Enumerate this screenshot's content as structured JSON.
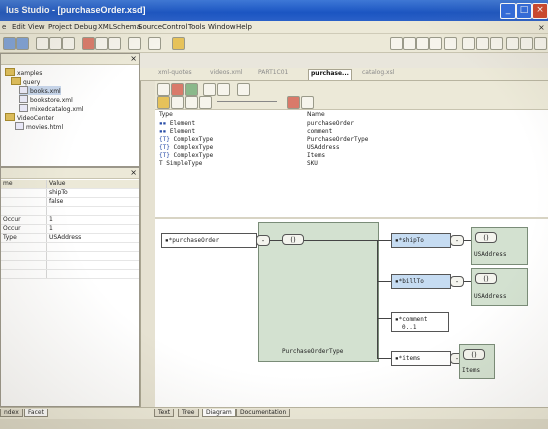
{
  "window": {
    "title": "lus Studio - [purchaseOrder.xsd]"
  },
  "menu": [
    "Edit",
    "View",
    "Project",
    "Debug",
    "XMLSchema",
    "SourceControl",
    "Tools",
    "Window",
    "Help"
  ],
  "menu_first_partial": "e",
  "project_tree": {
    "items": [
      "xamples",
      "query",
      "books.xml",
      "bookstore.xml",
      "mixedcatalog.xml",
      "VideoCenter",
      "movies.html"
    ]
  },
  "properties": {
    "header": {
      "name": "me",
      "value": "Value"
    },
    "rows": [
      {
        "name": "",
        "value": "shipTo"
      },
      {
        "name": "",
        "value": "false"
      },
      {
        "name": "",
        "value": ""
      },
      {
        "name": "Occur",
        "value": "1"
      },
      {
        "name": "Occur",
        "value": "1"
      },
      {
        "name": "Type",
        "value": "USAddress"
      },
      {
        "name": "",
        "value": ""
      },
      {
        "name": "",
        "value": ""
      },
      {
        "name": "",
        "value": ""
      },
      {
        "name": "",
        "value": ""
      }
    ]
  },
  "left_bottom_tabs": {
    "first": "ndex",
    "second": "Facet"
  },
  "doc_tabs": [
    "xml-quotes",
    "videos.xml",
    "PART1C01",
    "purchase...",
    "catalog.xsl"
  ],
  "type_table": {
    "headers": {
      "type": "Type",
      "name": "Name"
    },
    "rows": [
      {
        "type": "Element",
        "name": "purchaseOrder"
      },
      {
        "type": "Element",
        "name": "comment"
      },
      {
        "type": "ComplexType",
        "name": "PurchaseOrderType"
      },
      {
        "type": "ComplexType",
        "name": "USAddress"
      },
      {
        "type": "ComplexType",
        "name": "Items"
      },
      {
        "type": "SimpleType",
        "name": "SKU"
      }
    ]
  },
  "diagram": {
    "root": "purchaseOrder",
    "complex_type": "PurchaseOrderType",
    "elements": [
      {
        "name": "shipTo",
        "type": "USAddress"
      },
      {
        "name": "billTo",
        "type": "USAddress"
      },
      {
        "name": "comment",
        "occurs": "0..1"
      },
      {
        "name": "items",
        "type": "Items"
      }
    ],
    "seq_symbol": "()"
  },
  "editor_tabs": [
    "Text",
    "Tree",
    "Diagram",
    "Documentation"
  ]
}
